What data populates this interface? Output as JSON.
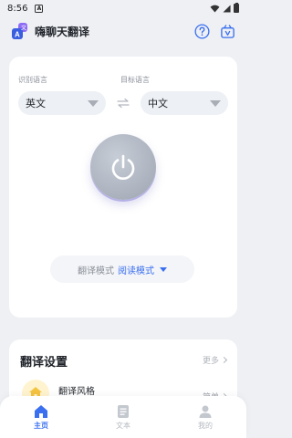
{
  "status_bar": {
    "time": "8:56",
    "notification_letter": "A"
  },
  "header": {
    "app_title": "嗨聊天翻译",
    "logo_letter": "A"
  },
  "languages": {
    "source_label": "识别语言",
    "target_label": "目标语言",
    "source_value": "英文",
    "target_value": "中文"
  },
  "mode": {
    "label": "翻译模式",
    "value": "阅读模式"
  },
  "settings": {
    "title": "翻译设置",
    "more_label": "更多",
    "style_label": "翻译风格",
    "style_value": "简单"
  },
  "bottom_nav": {
    "items": [
      {
        "label": "主页",
        "icon": "home-icon",
        "active": true
      },
      {
        "label": "文本",
        "icon": "document-icon",
        "active": false
      },
      {
        "label": "我的",
        "icon": "user-icon",
        "active": false
      }
    ]
  },
  "colors": {
    "accent": "#3a6ff0",
    "background": "#eef0f4",
    "power_button": "#aab1bd"
  }
}
